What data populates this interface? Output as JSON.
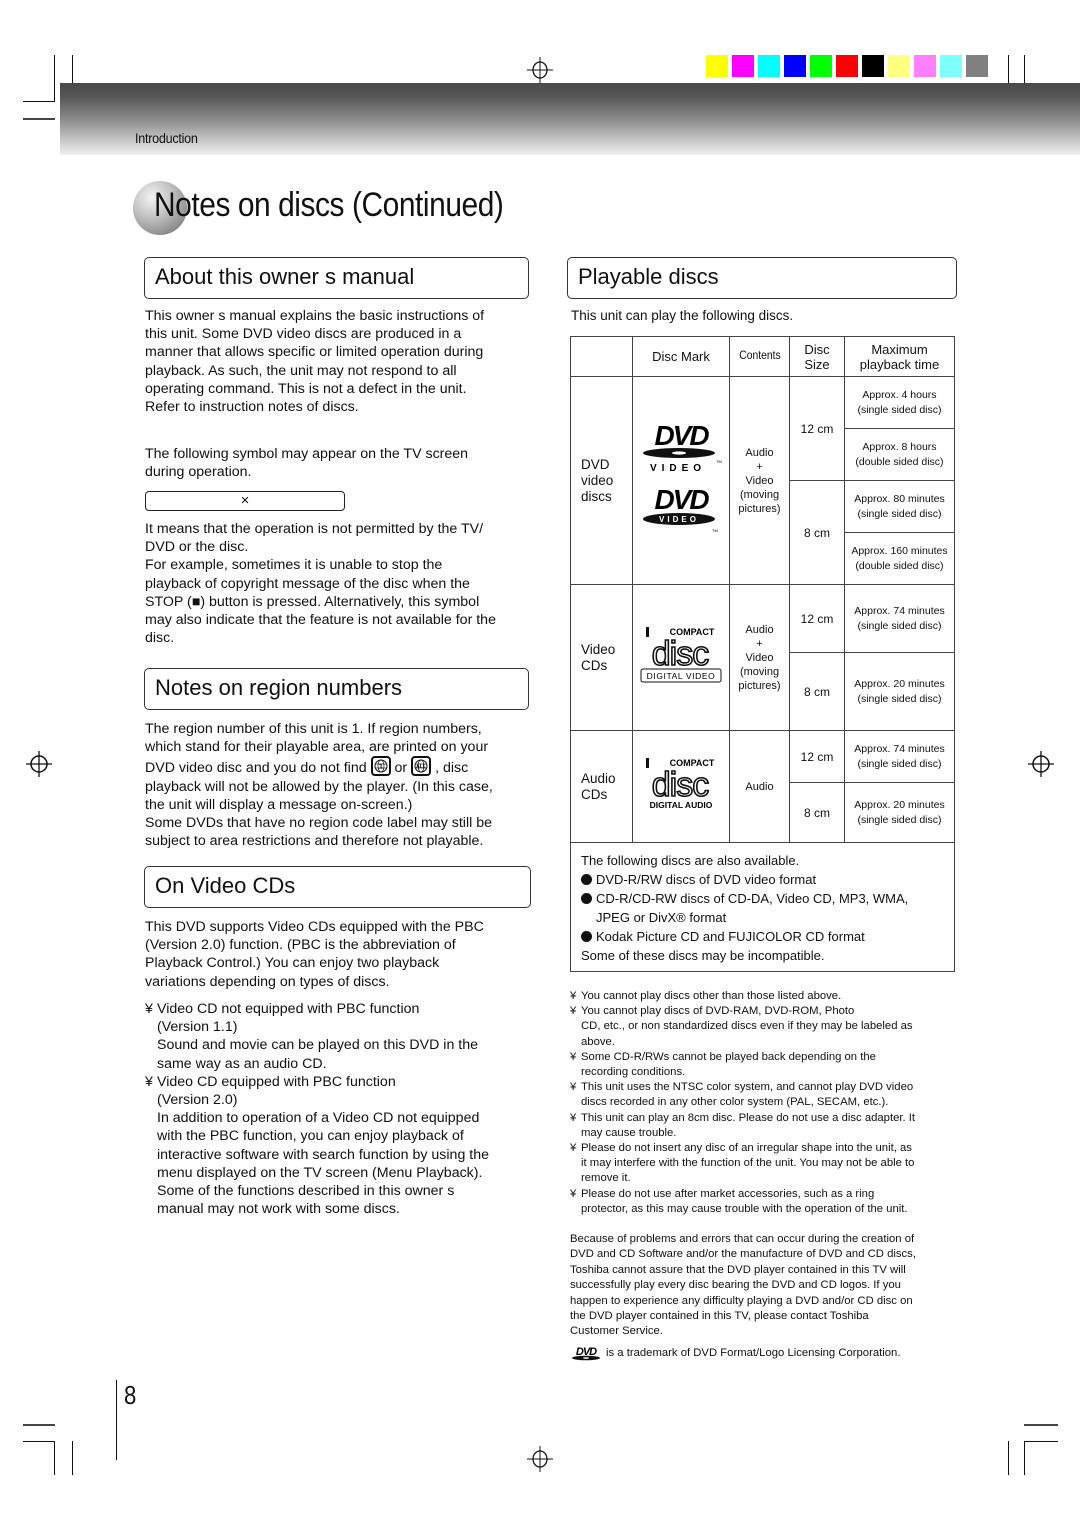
{
  "header": {
    "section_label": "Introduction",
    "swatch_colors": [
      "#ffff00",
      "#ff00ff",
      "#00ffff",
      "#0000ff",
      "#00ff00",
      "#ff0000",
      "#000000",
      "#ffff80",
      "#ff80ff",
      "#80ffff",
      "#808080"
    ]
  },
  "page_title": "Notes on discs (Continued)",
  "about_manual": {
    "heading": "About this owner s manual",
    "para1": [
      "This owner s manual explains the basic instructions of",
      "this unit. Some DVD video discs are produced in a",
      "manner that allows specific or limited operation during",
      "playback. As such, the unit may not respond to all",
      "operating command. This is not a defect in the unit.",
      "Refer to instruction notes of discs."
    ],
    "para2": [
      "The following symbol may appear on the TV screen",
      "during operation."
    ],
    "symbol": "×",
    "para3": [
      "It means that the operation is not permitted by the TV/",
      "DVD or the disc.",
      "For example, sometimes it is unable to stop the",
      "playback of copyright message of the disc when the",
      "STOP (■) button is pressed. Alternatively, this symbol",
      "may also indicate that the feature is not available for the",
      "disc."
    ]
  },
  "region": {
    "heading": "Notes on region numbers",
    "line1": "The region number of this unit is 1. If region numbers,",
    "line2": "which stand for their playable area, are printed on your",
    "line3_a": "DVD video disc and you do not find",
    "line3_or": "or",
    "line3_b": ", disc",
    "icon1_label": "1",
    "icon2_label": "ALL",
    "rest": [
      "playback will not be allowed by the player. (In this case,",
      "the unit will display a message on-screen.)",
      "Some DVDs that have no region code label may still be",
      "subject to area restrictions and therefore not playable."
    ]
  },
  "vcd": {
    "heading": "On Video CDs",
    "intro": [
      "This DVD supports Video CDs equipped with the PBC",
      "(Version 2.0) function. (PBC is the abbreviation of",
      "Playback Control.) You can enjoy two playback",
      "variations depending on types of discs."
    ],
    "bullet_mark": "¥",
    "items": [
      {
        "title": [
          "Video CD not equipped with PBC function",
          "(Version 1.1)"
        ],
        "body": [
          "Sound and movie can be played on this DVD in the",
          "same way as an audio CD."
        ]
      },
      {
        "title": [
          "Video CD equipped with PBC function",
          "(Version 2.0)"
        ],
        "body": [
          "In addition to operation of a Video CD not equipped",
          "with the PBC function, you can enjoy playback of",
          "interactive software with search function by using the",
          "menu displayed on the TV screen (Menu Playback).",
          "Some of the functions described in this owner s",
          "manual may not work with some discs."
        ]
      }
    ]
  },
  "playable": {
    "heading": "Playable discs",
    "intro": "This unit can play the following discs.",
    "table": {
      "headers": [
        "",
        "Disc Mark",
        "Contents",
        "Disc Size",
        "Maximum playback time"
      ],
      "header_size_lines": [
        "Disc",
        "Size"
      ],
      "header_time_lines": [
        "Maximum",
        "playback time"
      ],
      "rows": [
        {
          "type_lines": [
            "DVD",
            "video",
            "discs"
          ],
          "mark": "DVD VIDEO logo",
          "contents_lines": [
            "Audio",
            "+",
            "Video",
            "(moving",
            "pictures)"
          ],
          "sizes": [
            {
              "size": "12 cm",
              "times": [
                [
                  "Approx. 4 hours",
                  "(single sided disc)"
                ],
                [
                  "Approx. 8 hours",
                  "(double sided disc)"
                ]
              ]
            },
            {
              "size": "8 cm",
              "times": [
                [
                  "Approx. 80 minutes",
                  "(single sided disc)"
                ],
                [
                  "Approx. 160 minutes",
                  "(double sided disc)"
                ]
              ]
            }
          ]
        },
        {
          "type_lines": [
            "Video",
            "CDs"
          ],
          "mark": "COMPACT disc DIGITAL VIDEO logo",
          "mark_sub": "DIGITAL VIDEO",
          "contents_lines": [
            "Audio",
            "+",
            "Video",
            "(moving",
            "pictures)"
          ],
          "sizes": [
            {
              "size": "12 cm",
              "times": [
                [
                  "Approx. 74 minutes",
                  "(single sided disc)"
                ]
              ]
            },
            {
              "size": "8 cm",
              "times": [
                [
                  "Approx. 20 minutes",
                  "(single sided disc)"
                ]
              ]
            }
          ]
        },
        {
          "type_lines": [
            "Audio",
            "CDs"
          ],
          "mark": "COMPACT disc DIGITAL AUDIO logo",
          "mark_sub": "DIGITAL AUDIO",
          "contents_lines": [
            "Audio"
          ],
          "sizes": [
            {
              "size": "12 cm",
              "times": [
                [
                  "Approx. 74 minutes",
                  "(single sided disc)"
                ]
              ]
            },
            {
              "size": "8 cm",
              "times": [
                [
                  "Approx. 20 minutes",
                  "(single sided disc)"
                ]
              ]
            }
          ]
        }
      ],
      "logo_compact": "COMPACT",
      "logo_disc": "disc",
      "logo_dvd": "DVD",
      "logo_video": "VIDEO",
      "also": {
        "intro": "The following discs are also available.",
        "items": [
          [
            "DVD-R/RW discs of DVD video format"
          ],
          [
            "CD-R/CD-RW discs of CD-DA, Video CD, MP3, WMA,",
            "JPEG or DivX® format"
          ],
          [
            "Kodak Picture CD and FUJICOLOR CD format"
          ]
        ],
        "outro": "Some of these discs may be incompatible."
      }
    },
    "notes": [
      [
        "You cannot play discs other than those listed above."
      ],
      [
        "You cannot play discs of DVD-RAM, DVD-ROM, Photo",
        "CD, etc., or non standardized discs even if they may be labeled as",
        "above."
      ],
      [
        "Some CD-R/RWs cannot be played back depending on the",
        "recording conditions."
      ],
      [
        "This unit uses the NTSC color system, and cannot play DVD video",
        "discs recorded in any other color system (PAL, SECAM, etc.)."
      ],
      [
        "This unit can play an 8cm disc. Please do not use a disc adapter. It",
        "may cause trouble."
      ],
      [
        "Please do not insert any disc of an irregular shape into the unit, as",
        "it may interfere with the function of the unit. You may not be able to",
        "remove it."
      ],
      [
        "Please do not use after market accessories, such as a ring",
        "protector, as this may cause trouble with the operation of the unit."
      ]
    ],
    "disclaimer": [
      "Because of problems and errors that can occur during the creation of",
      "DVD and CD Software and/or the manufacture of DVD and CD discs,",
      "Toshiba cannot assure that the DVD player contained in this TV will",
      "successfully play every disc bearing the DVD and CD logos.  If you",
      "happen to experience any difficulty playing a DVD and/or CD disc on",
      "the DVD player contained in this TV, please contact Toshiba",
      "Customer Service."
    ],
    "trademark": "is a trademark of DVD Format/Logo Licensing Corporation."
  },
  "page_number": "8"
}
